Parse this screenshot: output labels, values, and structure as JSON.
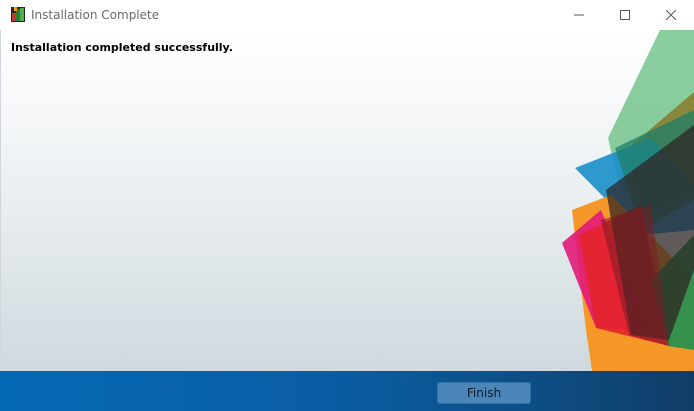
{
  "window": {
    "title": "Installation Complete",
    "icon": "installer-app-icon",
    "controls": {
      "minimize_icon": "minimize-icon",
      "maximize_icon": "maximize-icon",
      "close_icon": "close-icon"
    }
  },
  "main": {
    "message": "Installation completed successfully."
  },
  "footer": {
    "finish_label": "Finish"
  },
  "colors": {
    "footer_blue": "#0569b5",
    "decor_green": "#7cc693",
    "decor_blue": "#1a8fc9",
    "decor_orange": "#f7941d",
    "decor_red": "#e3232c",
    "decor_magenta": "#e2197a",
    "decor_dark": "#3a2a2a"
  }
}
